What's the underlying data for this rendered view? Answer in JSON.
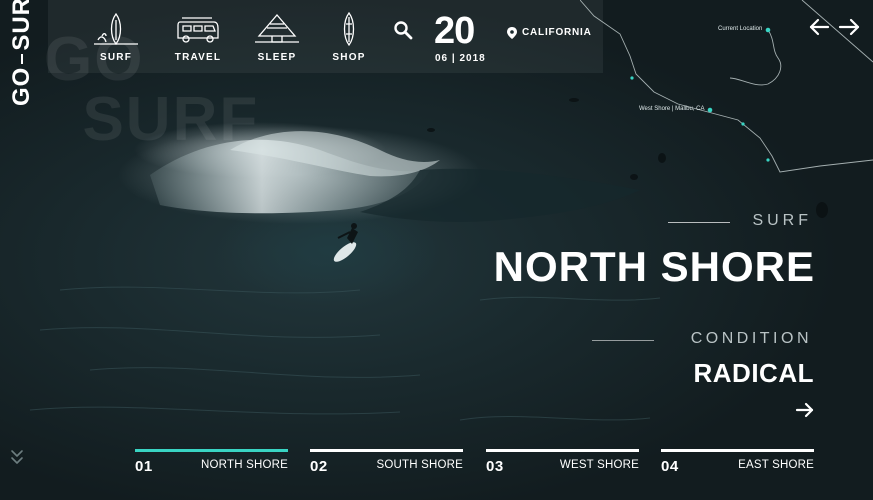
{
  "brand": {
    "text_before": "GO",
    "text_after": "SURF"
  },
  "nav": {
    "items": [
      {
        "label": "SURF",
        "icon": "surfboard-icon"
      },
      {
        "label": "TRAVEL",
        "icon": "van-icon"
      },
      {
        "label": "SLEEP",
        "icon": "cabin-icon"
      },
      {
        "label": "SHOP",
        "icon": "board-shop-icon"
      }
    ],
    "search_icon": "search-icon"
  },
  "date": {
    "day": "20",
    "month_year": "06 | 2018"
  },
  "location": {
    "label": "CALIFORNIA",
    "icon": "location-pin-icon"
  },
  "map": {
    "current_location_label": "Current Location",
    "spot_label": "West Shore | Malibu, CA",
    "accent_color": "#39d4c3"
  },
  "pager": {
    "prev_icon": "arrow-left-icon",
    "next_icon": "arrow-right-icon"
  },
  "hero": {
    "category": "SURF",
    "title": "NORTH SHORE",
    "condition_label": "CONDITION",
    "condition_value": "RADICAL",
    "go_icon": "arrow-right-icon"
  },
  "tabs": [
    {
      "num": "01",
      "name": "NORTH SHORE",
      "active": true
    },
    {
      "num": "02",
      "name": "SOUTH SHORE",
      "active": false
    },
    {
      "num": "03",
      "name": "WEST SHORE",
      "active": false
    },
    {
      "num": "04",
      "name": "EAST SHORE",
      "active": false
    }
  ],
  "colors": {
    "accent": "#39d4c3",
    "text": "#ffffff",
    "muted": "#b9c3c5"
  }
}
